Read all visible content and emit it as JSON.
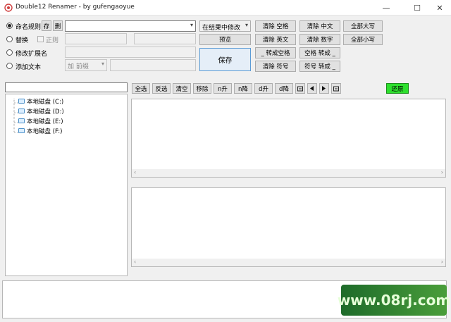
{
  "window": {
    "title": "Double12 Renamer - by gufengaoyue",
    "minimize_icon": "—",
    "maximize_icon": "☐",
    "close_icon": "✕"
  },
  "options": {
    "rule_label": "命名规则",
    "save_rule_btn": "存",
    "delete_rule_btn": "删",
    "replace_label": "替换",
    "regex_label": "正则",
    "ext_label": "修改扩展名",
    "add_text_label": "添加文本",
    "add_position_value": "加 前缀"
  },
  "actions": {
    "mode_select": "在结果中修改",
    "preview": "预览",
    "save": "保存"
  },
  "transform": {
    "col1": [
      "清除 空格",
      "清除 英文",
      "_ 转成空格",
      "清除 符号"
    ],
    "col2": [
      "清除 中文",
      "清除 数字",
      "空格 转成 _",
      "符号 转成 _"
    ],
    "col3": [
      "全部大写",
      "全部小写"
    ]
  },
  "drives": [
    "本地磁盘 (C:)",
    "本地磁盘 (D:)",
    "本地磁盘 (E:)",
    "本地磁盘 (F:)"
  ],
  "toolbar": {
    "select_all": "全选",
    "invert": "反选",
    "clear": "清空",
    "remove": "移除",
    "n_up": "n升",
    "n_down": "n降",
    "d_up": "d升",
    "d_down": "d降",
    "restore": "还原"
  },
  "watermark": "www.08rj.com"
}
